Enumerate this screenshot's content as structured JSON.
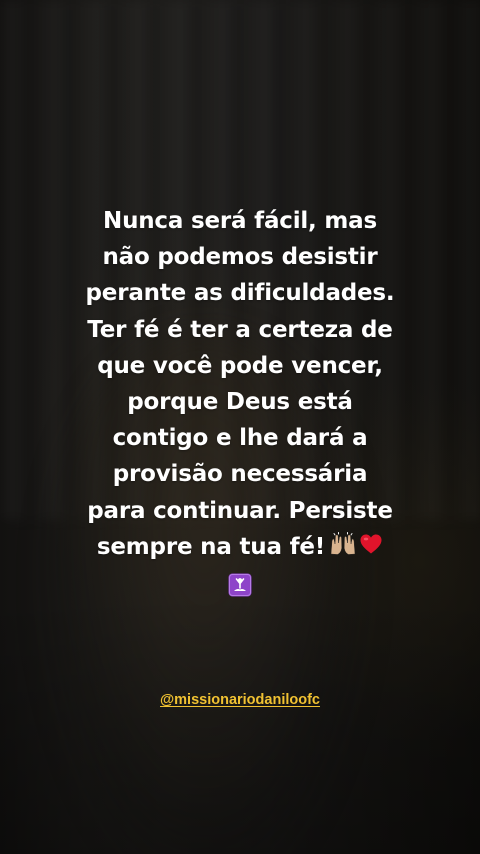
{
  "story": {
    "quote_lines": [
      "Nunca será fácil, mas",
      "não podemos desistir",
      "perante as dificuldades.",
      "Ter fé é ter a certeza de",
      "que você pode vencer,",
      "porque Deus está",
      "contigo e lhe dará a",
      "provisão necessária",
      "para continuar. Persiste",
      "sempre na tua fé!"
    ],
    "emojis": [
      "raising-hands-icon",
      "red-heart-icon",
      "person-in-lotus-position-icon"
    ],
    "handle": "@missionariodaniloofc",
    "colors": {
      "text": "#ffffff",
      "handle": "#f1c232",
      "emoji_tile": "#8e44c9",
      "heart": "#e0142b",
      "hands_skin": "#d9b48f"
    }
  }
}
